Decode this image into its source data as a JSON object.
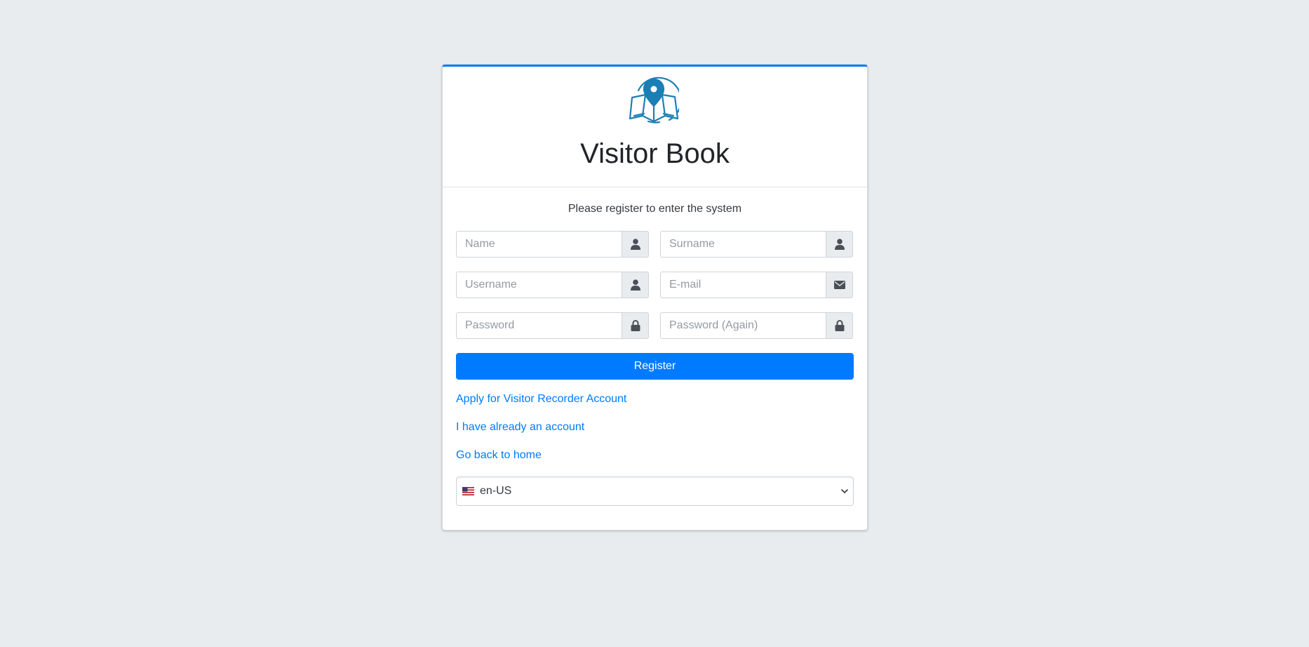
{
  "brand": {
    "title": "Visitor Book",
    "logo_icon": "map-pin-book-icon",
    "accent_color": "#007bff",
    "logo_color": "#1b7fb5"
  },
  "form": {
    "message": "Please register to enter the system",
    "fields": {
      "name": {
        "placeholder": "Name",
        "value": "",
        "icon": "user-icon"
      },
      "surname": {
        "placeholder": "Surname",
        "value": "",
        "icon": "user-icon"
      },
      "username": {
        "placeholder": "Username",
        "value": "",
        "icon": "user-icon"
      },
      "email": {
        "placeholder": "E-mail",
        "value": "",
        "icon": "envelope-icon"
      },
      "password": {
        "placeholder": "Password",
        "value": "",
        "icon": "lock-icon"
      },
      "password_again": {
        "placeholder": "Password (Again)",
        "value": "",
        "icon": "lock-icon"
      }
    },
    "register_label": "Register"
  },
  "links": {
    "apply": "Apply for Visitor Recorder Account",
    "login": "I have already an account",
    "home": "Go back to home"
  },
  "language": {
    "selected": "en-US",
    "flag_icon": "us-flag-icon",
    "chevron_icon": "chevron-down-icon"
  }
}
